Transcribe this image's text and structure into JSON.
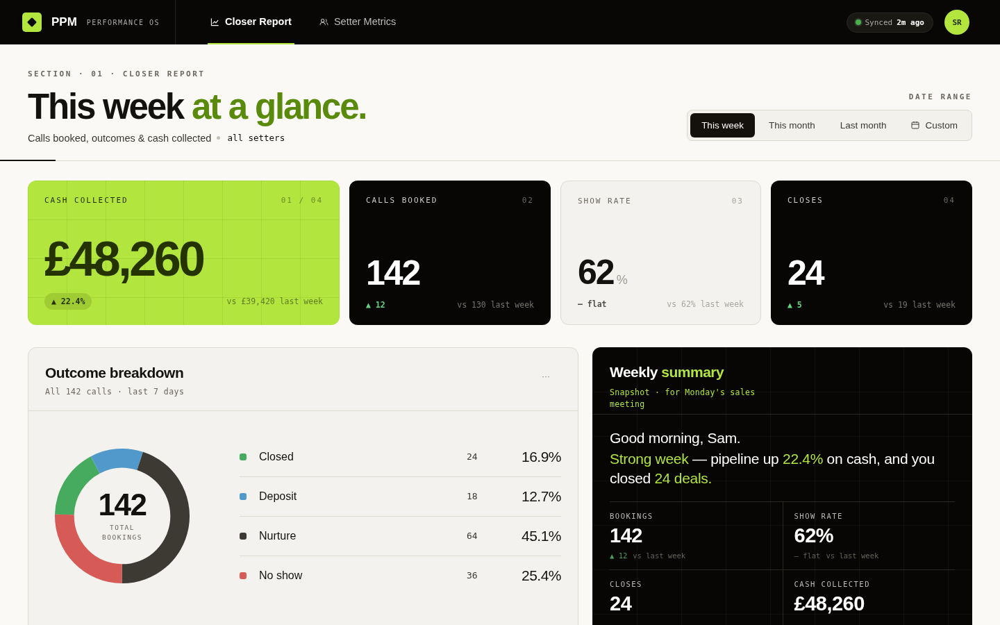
{
  "brand": {
    "name": "PPM",
    "tagline": "PERFORMANCE OS"
  },
  "nav": [
    {
      "label": "Closer Report",
      "selected": true,
      "kind": "chart"
    },
    {
      "label": "Setter Metrics",
      "selected": false,
      "kind": "people"
    }
  ],
  "sync": {
    "label": "Synced",
    "time": "2m ago",
    "online": true
  },
  "avatar": {
    "initials": "SR"
  },
  "eyebrow": "SECTION · 01 · CLOSER REPORT",
  "headline": {
    "lead": "This week",
    "accent": "at a glance."
  },
  "subtitle": "Calls booked, outcomes & cash collected",
  "scope": "all setters",
  "date_range": {
    "label": "DATE RANGE",
    "options": [
      {
        "label": "This week",
        "selected": true
      },
      {
        "label": "This month",
        "selected": false
      },
      {
        "label": "Last month",
        "selected": false
      },
      {
        "label": "Custom",
        "selected": false,
        "kind": "calendar"
      }
    ]
  },
  "stat_cards": [
    {
      "kind": "lime",
      "label": "CASH COLLECTED",
      "index": "01 / 04",
      "value": "£48,260",
      "delta": "▲ 22.4%",
      "color": "#243300",
      "compare": "vs £39,420 last week"
    },
    {
      "kind": "dark",
      "label": "CALLS BOOKED",
      "index": "02",
      "value": "142",
      "delta": "▲ 12",
      "color": "#64d383",
      "compare": "vs 130 last week"
    },
    {
      "kind": "light",
      "label": "SHOW RATE",
      "index": "03",
      "value": "62",
      "unit": "%",
      "delta": "— flat",
      "color": "#55524b",
      "compare": "vs 62% last week"
    },
    {
      "kind": "dark",
      "label": "CLOSES",
      "index": "04",
      "value": "24",
      "delta": "▲ 5",
      "color": "#64d383",
      "compare": "vs 19 last week"
    }
  ],
  "outcomes": {
    "title": "Outcome breakdown",
    "subtitle": "All 142 calls · last 7 days",
    "menu": "···",
    "total": "142",
    "total_label": "TOTAL BOOKINGS",
    "chart_data": {
      "type": "donut",
      "values": [
        16.9,
        12.7,
        45.1,
        25.3
      ]
    },
    "items": [
      {
        "name": "Closed",
        "count": "24",
        "share": "16.9%",
        "color": "#47ab5f"
      },
      {
        "name": "Deposit",
        "count": "18",
        "share": "12.7%",
        "color": "#5299cb"
      },
      {
        "name": "Nurture",
        "count": "64",
        "share": "45.1%",
        "color": "#3d3a33"
      },
      {
        "name": "No show",
        "count": "36",
        "share": "25.4%",
        "color": "#d65a55"
      }
    ]
  },
  "summary": {
    "title": {
      "lead": "Weekly",
      "accent": "summary"
    },
    "subtitle": "Snapshot · for Monday's sales meeting",
    "greeting": "Good morning, Sam.",
    "message": "**Strong week** — pipeline up **22.4%** on cash, and you closed **24 deals.**",
    "stats": [
      {
        "label": "BOOKINGS",
        "value": "142",
        "delta": "▲ 12",
        "color": "#4c9a5c",
        "note": "vs last week"
      },
      {
        "label": "SHOW RATE",
        "value": "62%",
        "delta": "— flat",
        "color": "#66635b",
        "note": "vs last week"
      },
      {
        "label": "CLOSES",
        "value": "24"
      },
      {
        "label": "CASH COLLECTED",
        "value": "£48,260"
      }
    ]
  }
}
